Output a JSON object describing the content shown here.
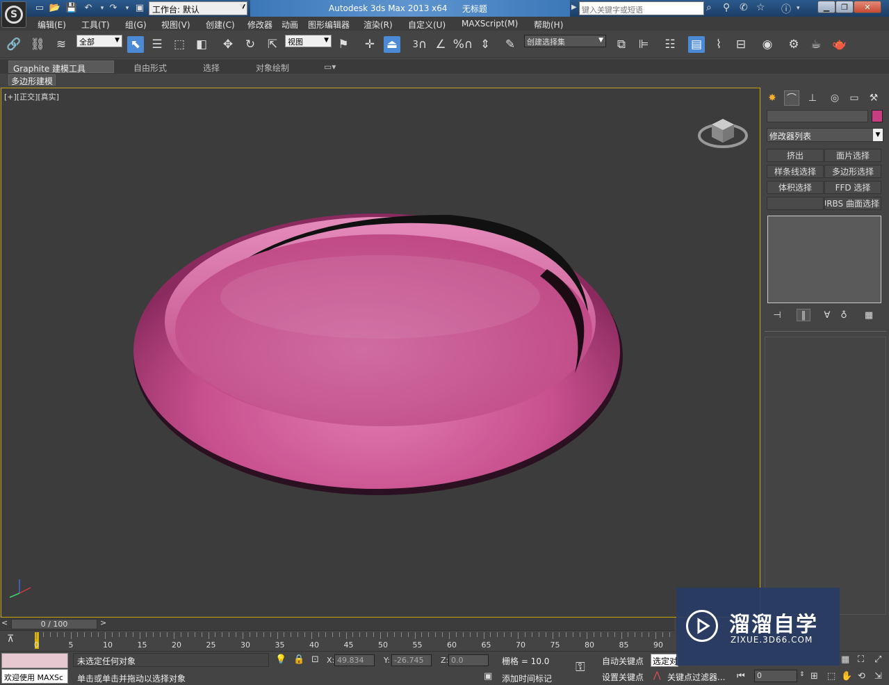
{
  "title_bar": {
    "workspace_label": "工作台: 默认",
    "app_name": "Autodesk 3ds Max  2013 x64",
    "document": "无标题",
    "search_placeholder": "键入关键字或短语"
  },
  "menu": [
    "编辑(E)",
    "工具(T)",
    "组(G)",
    "视图(V)",
    "创建(C)",
    "修改器",
    "动画",
    "图形编辑器",
    "渲染(R)",
    "自定义(U)",
    "MAXScript(M)",
    "帮助(H)"
  ],
  "toolbar": {
    "filter_value": "全部",
    "ref_coord_value": "视图",
    "selection_set_placeholder": "创建选择集",
    "snap_3": "3",
    "percent_snap": "%"
  },
  "ribbon": {
    "tabs": [
      "Graphite 建模工具",
      "自由形式",
      "选择",
      "对象绘制"
    ],
    "subtab": "多边形建模"
  },
  "viewport": {
    "label": "[+][正交][真实]",
    "object_color": "#c83c82"
  },
  "command_panel": {
    "modifier_list": "修改器列表",
    "buttons": [
      "挤出",
      "面片选择",
      "样条线选择",
      "多边形选择",
      "体积选择",
      "FFD 选择",
      "",
      "NURBS 曲面选择"
    ],
    "color": "#c83c82"
  },
  "timeline": {
    "slider": "0 / 100",
    "ticks": [
      "0",
      "5",
      "10",
      "15",
      "20",
      "25",
      "30",
      "35",
      "40",
      "45",
      "50",
      "55",
      "60",
      "65",
      "70",
      "75",
      "80",
      "85",
      "90"
    ]
  },
  "status": {
    "welcome": "欢迎使用 MAXSc",
    "selection_status": "未选定任何对象",
    "prompt": "单击或单击并拖动以选择对象",
    "x_label": "X:",
    "x_value": "49.834",
    "y_label": "Y:",
    "y_value": "-26.745",
    "z_label": "Z:",
    "z_value": "0.0",
    "grid": "栅格 = 10.0",
    "auto_key": "自动关键点",
    "set_key": "设置关键点",
    "selected_combo": "选定对",
    "key_filters": "关键点过滤器...",
    "add_time_tag": "添加时间标记",
    "frame_value": "0"
  },
  "watermark": {
    "title": "溜溜自学",
    "subtitle": "ZIXUE.3D66.COM"
  }
}
